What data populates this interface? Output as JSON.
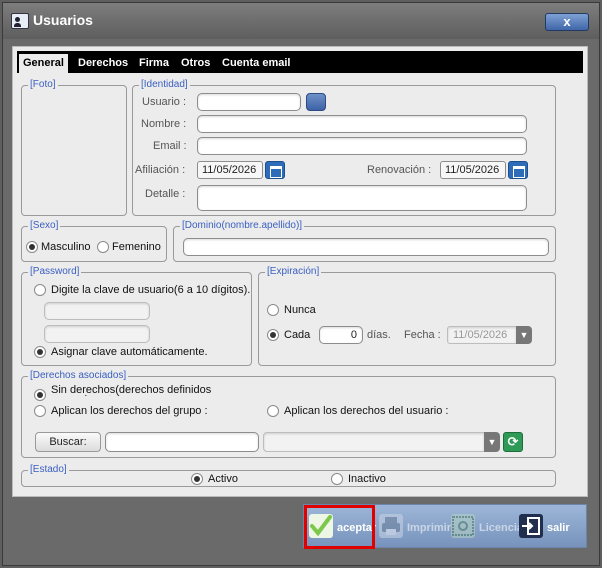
{
  "window": {
    "title": "Usuarios",
    "close_label": "x"
  },
  "tabs": [
    {
      "label": "General",
      "active": true
    },
    {
      "label": "Derechos"
    },
    {
      "label": "Firma"
    },
    {
      "label": "Otros"
    },
    {
      "label": "Cuenta email"
    }
  ],
  "foto": {
    "legend": "[Foto]"
  },
  "identidad": {
    "legend": "[Identidad]",
    "usuario_label": "Usuario :",
    "usuario_value": "",
    "nombre_label": "Nombre :",
    "nombre_value": "",
    "email_label": "Email :",
    "email_value": "",
    "afiliacion_label": "Afiliación :",
    "afiliacion_value": "11/05/2026",
    "renovacion_label": "Renovación :",
    "renovacion_value": "11/05/2026",
    "detalle_label": "Detalle :",
    "detalle_value": ""
  },
  "sexo": {
    "legend": "[Sexo]",
    "masculino": "Masculino",
    "femenino": "Femenino",
    "selected": "masculino"
  },
  "dominio": {
    "legend": "[Dominio(nombre.apellido)]",
    "value": ""
  },
  "password": {
    "legend": "[Password]",
    "manual_label": "Digite la clave de usuario(6 a 10 dígitos).",
    "auto_label": "Asignar clave automáticamente.",
    "selected": "auto"
  },
  "expiracion": {
    "legend": "[Expiración]",
    "nunca": "Nunca",
    "cada": "Cada",
    "dias_value": "0",
    "dias_label": "días.",
    "fecha_label": "Fecha :",
    "fecha_value": "11/05/2026",
    "selected": "cada"
  },
  "derechos": {
    "legend": "[Derechos asociados]",
    "sin": "Sin derechos(derechos definidos manualmente)",
    "grupo": "Aplican los derechos del grupo :",
    "usuario": "Aplican los derechos del usuario :",
    "buscar_label": "Buscar:",
    "buscar_value": "",
    "combo_value": "",
    "selected": "sin"
  },
  "estado": {
    "legend": "[Estado]",
    "activo": "Activo",
    "inactivo": "Inactivo",
    "selected": "activo"
  },
  "actions": {
    "aceptar": "aceptar",
    "imprimir": "Imprimir",
    "licencia": "Licencia",
    "salir": "salir"
  },
  "colors": {
    "accent": "#3a5fc2",
    "highlight": "#e00000",
    "check": "#7cc84a"
  }
}
